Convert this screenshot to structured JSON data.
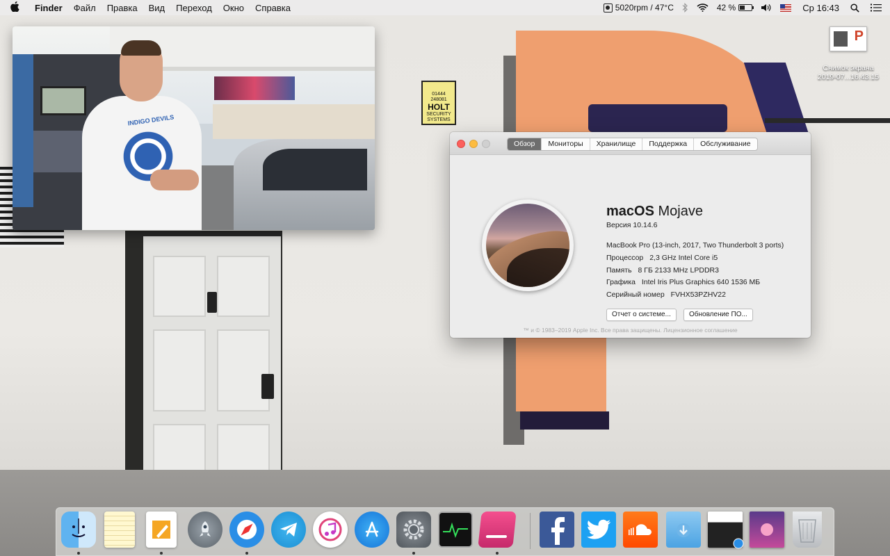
{
  "menubar": {
    "apple_icon": "apple-logo",
    "app_name": "Finder",
    "items": [
      "Файл",
      "Правка",
      "Вид",
      "Переход",
      "Окно",
      "Справка"
    ],
    "fan_status": "5020rpm / 47°C",
    "battery_percent": "42 %",
    "battery_level": 0.42,
    "clock": "Ср 16:43",
    "status_icons": [
      "fan-icon",
      "bluetooth-icon",
      "wifi-icon",
      "battery-icon",
      "volume-icon",
      "us-flag-icon",
      "search-icon",
      "menu-list-icon"
    ]
  },
  "desktop": {
    "screenshot_file": {
      "line1": "Снимок экрана",
      "line2": "2019-07...16.43.15"
    },
    "wall_sign": {
      "phone1": "01444",
      "phone2": "248081",
      "brand": "HOLT",
      "sub1": "SECURITY",
      "sub2": "SYSTEMS"
    }
  },
  "video_window": {
    "shirt_text": "INDIGO DEVILS"
  },
  "about_window": {
    "tabs": [
      "Обзор",
      "Мониторы",
      "Хранилище",
      "Поддержка",
      "Обслуживание"
    ],
    "active_tab": "Обзор",
    "os_name_bold": "macOS",
    "os_name_light": "Mojave",
    "version_label": "Версия",
    "version": "10.14.6",
    "model": "MacBook Pro (13-inch, 2017, Two Thunderbolt 3 ports)",
    "specs": [
      {
        "label": "Процессор",
        "value": "2,3 GHz Intel Core i5"
      },
      {
        "label": "Память",
        "value": "8 ГБ 2133 MHz LPDDR3"
      },
      {
        "label": "Графика",
        "value": "Intel Iris Plus Graphics 640 1536 МБ"
      },
      {
        "label": "Серийный номер",
        "value": "FVHX53PZHV22"
      }
    ],
    "buttons": {
      "system_report": "Отчет о системе...",
      "software_update": "Обновление ПО..."
    },
    "copyright": "™ и © 1983–2019 Apple Inc. Все права защищены. Лицензионное соглашение"
  },
  "dock": {
    "items": [
      {
        "name": "finder",
        "running": true
      },
      {
        "name": "notes",
        "running": false
      },
      {
        "name": "pages",
        "running": true
      },
      {
        "name": "launchpad",
        "running": false
      },
      {
        "name": "safari",
        "running": true
      },
      {
        "name": "telegram",
        "running": false
      },
      {
        "name": "itunes",
        "running": false
      },
      {
        "name": "app-store",
        "running": false
      },
      {
        "name": "system-preferences",
        "running": true
      },
      {
        "name": "activity-monitor",
        "running": false
      },
      {
        "name": "cleanmymac",
        "running": true
      },
      {
        "name": "facebook",
        "running": false
      },
      {
        "name": "twitter",
        "running": false
      },
      {
        "name": "soundcloud",
        "running": false
      },
      {
        "name": "downloads-folder",
        "running": false
      },
      {
        "name": "recent-window-1",
        "running": false
      },
      {
        "name": "recent-window-2",
        "running": false
      },
      {
        "name": "trash",
        "running": false
      }
    ]
  }
}
